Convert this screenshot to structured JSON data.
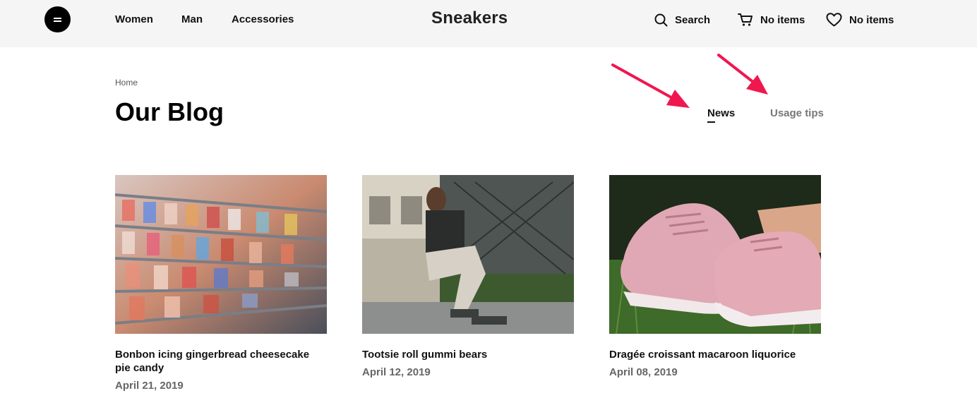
{
  "header": {
    "brand": "Sneakers",
    "nav": [
      "Women",
      "Man",
      "Accessories"
    ],
    "search_label": "Search",
    "cart_label": "No items",
    "wishlist_label": "No items"
  },
  "breadcrumb": "Home",
  "page_title": "Our Blog",
  "tabs": [
    {
      "label": "News",
      "active": true
    },
    {
      "label": "Usage tips",
      "active": false
    }
  ],
  "annotations": {
    "arrow_color": "#f0174f"
  },
  "posts": [
    {
      "title": "Bonbon icing gingerbread cheesecake pie candy",
      "date": "April 21, 2019",
      "image": "shoe-store-shelves-photo"
    },
    {
      "title": "Tootsie roll gummi bears",
      "date": "April 12, 2019",
      "image": "man-crouching-in-sneakers-photo"
    },
    {
      "title": "Dragée croissant macaroon liquorice",
      "date": "April 08, 2019",
      "image": "pink-sneakers-on-grass-photo"
    }
  ]
}
